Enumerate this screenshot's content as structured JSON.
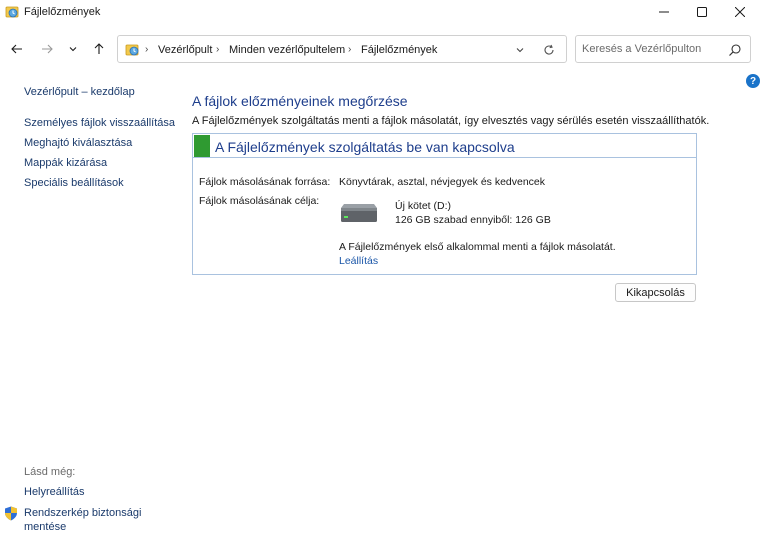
{
  "window": {
    "title": "Fájlelőzmények"
  },
  "address": {
    "crumbs": [
      "Vezérlőpult",
      "Minden vezérlőpultelem",
      "Fájlelőzmények"
    ]
  },
  "search": {
    "placeholder": "Keresés a Vezérlőpulton"
  },
  "help": {
    "label": "?"
  },
  "sidebar": {
    "home": "Vezérlőpult – kezdőlap",
    "items": [
      {
        "label": "Személyes fájlok visszaállítása"
      },
      {
        "label": "Meghajtó kiválasztása"
      },
      {
        "label": "Mappák kizárása"
      },
      {
        "label": "Speciális beállítások"
      }
    ],
    "see_also_heading": "Lásd még:",
    "see_also": [
      {
        "label": "Helyreállítás"
      },
      {
        "label": "Rendszerkép biztonsági mentése"
      }
    ]
  },
  "main": {
    "title": "A fájlok előzményeinek megőrzése",
    "description": "A Fájlelőzmények szolgáltatás menti a fájlok másolatát, így elvesztés vagy sérülés esetén visszaállíthatók.",
    "status_title": "A Fájlelőzmények szolgáltatás be van kapcsolva",
    "status_color": "#2f9a31",
    "source_label": "Fájlok másolásának forrása:",
    "source_value": "Könyvtárak, asztal, névjegyek és kedvencek",
    "target_label": "Fájlok másolásának célja:",
    "drive_name": "Új kötet (D:)",
    "drive_space": "126 GB szabad ennyiből: 126 GB",
    "first_note": "A Fájlelőzmények első alkalommal menti a fájlok másolatát.",
    "stop_link": "Leállítás",
    "turn_off_button": "Kikapcsolás"
  }
}
